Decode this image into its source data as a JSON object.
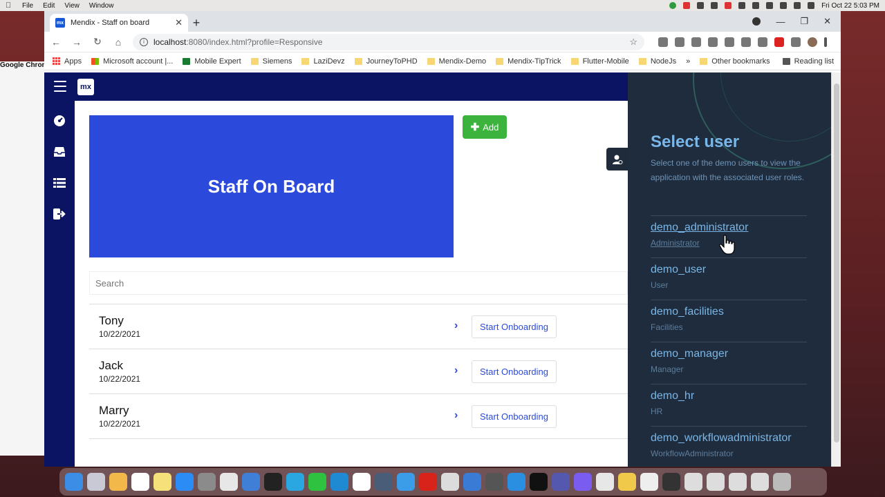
{
  "menubar": {
    "app_name": "Google Chrome",
    "menus": [
      "File",
      "Edit",
      "View",
      "Window"
    ],
    "clock": "Fri Oct 22  5:03 PM"
  },
  "browser": {
    "tab_title": "Mendix - Staff on board",
    "tab_favicon": "mx",
    "url_host": "localhost",
    "url_path": ":8080/index.html?profile=Responsive",
    "bookmarks": [
      "Apps",
      "Microsoft account |...",
      "Mobile Expert",
      "Siemens",
      "LaziDevz",
      "JourneyToPHD",
      "Mendix-Demo",
      "Mendix-TipTrick",
      "Flutter-Mobile",
      "NodeJs"
    ],
    "bookmarks_overflow": "»",
    "other_bookmarks": "Other bookmarks",
    "reading_list": "Reading list"
  },
  "app": {
    "logo": "mx",
    "hero_title": "Staff On Board",
    "add_label": "Add",
    "search_placeholder": "Search",
    "staff": [
      {
        "name": "Tony",
        "date": "10/22/2021",
        "action": "Start Onboarding"
      },
      {
        "name": "Jack",
        "date": "10/22/2021",
        "action": "Start Onboarding"
      },
      {
        "name": "Marry",
        "date": "10/22/2021",
        "action": "Start Onboarding"
      }
    ]
  },
  "select_user": {
    "title": "Select user",
    "description": "Select one of the demo users to view the application with the associated user roles.",
    "users": [
      {
        "name": "demo_administrator",
        "role": "Administrator"
      },
      {
        "name": "demo_user",
        "role": "User"
      },
      {
        "name": "demo_facilities",
        "role": "Facilities"
      },
      {
        "name": "demo_manager",
        "role": "Manager"
      },
      {
        "name": "demo_hr",
        "role": "HR"
      },
      {
        "name": "demo_workflowadministrator",
        "role": "WorkflowAdministrator"
      }
    ]
  },
  "colors": {
    "nav": "#0a1463",
    "hero": "#2b4adc",
    "add": "#3cb33c",
    "panel": "#1e2c3d",
    "panel_text": "#7ab7e8"
  }
}
